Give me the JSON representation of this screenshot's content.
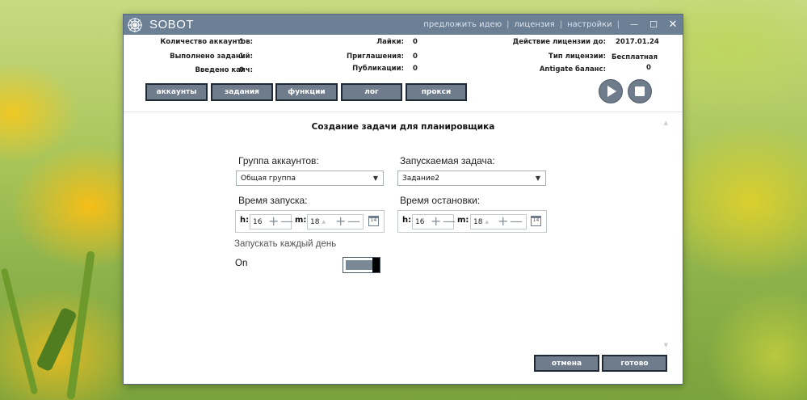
{
  "titlebar": {
    "app_title": "SOBOT",
    "links": [
      "предложить идею",
      "лицензия",
      "настройки"
    ],
    "controls": [
      "—",
      "☐",
      "✕"
    ]
  },
  "info": {
    "accounts_label": "Количество аккаунтов:",
    "accounts_value": "1",
    "tasks_label": "Выполнено заданий:",
    "tasks_value": "1",
    "captcha_label": "Введено капч:",
    "captcha_value": "0",
    "likes_label": "Лайки:",
    "likes_value": "0",
    "invites_label": "Приглашения:",
    "invites_value": "0",
    "posts_label": "Публикации:",
    "posts_value": "0",
    "license_until_label": "Действие лицензии до:",
    "license_until_value": "2017.01.24",
    "license_type_label": "Тип лицензии:",
    "license_type_value": "Бесплатная",
    "antigate_label": "Antigate баланс:",
    "antigate_value": "0"
  },
  "tabs": [
    "аккаунты",
    "задания",
    "функции",
    "лог",
    "прокси"
  ],
  "page_title": "Создание задачи для планировщика",
  "form": {
    "group_label": "Группа аккаунтов:",
    "group_value": "Общая группа",
    "task_label": "Запускаемая задача:",
    "task_value": "Задание2",
    "start_label": "Время запуска:",
    "start_h_label": "h:",
    "start_h": "16",
    "start_m_label": "m:",
    "start_m": "18",
    "stop_label": "Время остановки:",
    "stop_h_label": "h:",
    "stop_h": "16",
    "stop_m_label": "m:",
    "stop_m": "18",
    "calendar_day": "14",
    "daily_label": "Запускать каждый день",
    "toggle_state": "On"
  },
  "buttons": {
    "cancel": "отмена",
    "done": "готово"
  },
  "colors": {
    "titlebar": "#6b7f95",
    "button": "#6e7c8c",
    "button_border": "#1f2a36"
  }
}
